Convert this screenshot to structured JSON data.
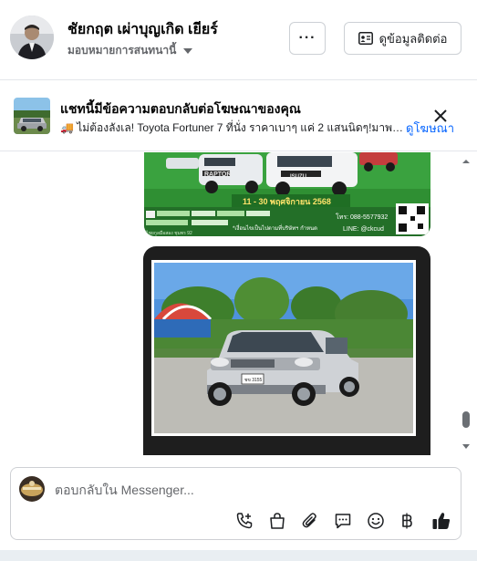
{
  "header": {
    "name": "ชัยกฤต เผ่าบุญเกิด เยียร์",
    "assign_label": "มอบหมายการสนทนานี้",
    "more_label": "···",
    "contact_label": "ดูข้อมูลติดต่อ"
  },
  "banner": {
    "title": "แชทนี้มีข้อความตอบกลับต่อโฆษณาของคุณ",
    "text": "🚚 ไม่ต้องลังเล! Toyota Fortuner 7 ที่นั่ง ราคาเบาๆ แค่ 2 แสนนิดๆ!มาพร้อ...",
    "link_label": "ดูโฆษณา"
  },
  "ad_image_1": {
    "date_text": "11 - 30 พฤศจิกายน 2568",
    "phone_text": "โทร: 088-5577932",
    "line_text": "LINE: @ckcud",
    "tagline": "*เงื่อนไขเป็นไปตามที่บริษัทฯ กำหนด",
    "dealer_text": "ไชยกูลมือสอง ชุมพร 92",
    "brand_grille_1": "RAPTOR",
    "brand_grille_2": "ISUZU"
  },
  "ad_image_2": {
    "plate_text": "ชข 3155"
  },
  "composer": {
    "placeholder": "ตอบกลับใน Messenger..."
  },
  "icons": {
    "more": "more-icon",
    "contact": "contact-card-icon",
    "close": "close-icon",
    "call_add": "add-call-icon",
    "shop": "shopping-bag-icon",
    "attach": "paperclip-icon",
    "saved_reply": "chat-bubble-icon",
    "emoji": "smile-icon",
    "payment": "baht-icon",
    "like": "thumbs-up-icon"
  },
  "colors": {
    "accent": "#0866ff",
    "like": "#1c1e21",
    "border": "#ced0d4",
    "ad_green": "#2e8b2e"
  }
}
